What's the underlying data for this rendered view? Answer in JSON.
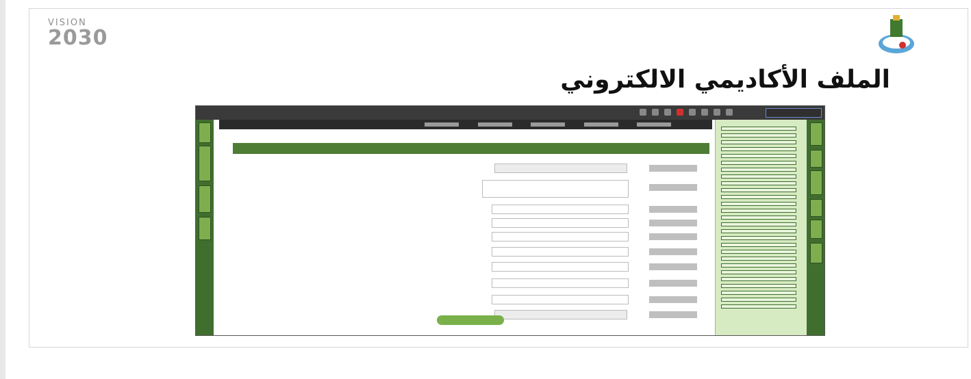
{
  "slide": {
    "title": "الملف الأكاديمي الالكتروني"
  },
  "vision_logo": {
    "line1": "VISION",
    "year": "2030"
  },
  "colors": {
    "accent_green": "#3f6e2e",
    "submit_green": "#79b04a",
    "sidebar_bg": "#d7ebc3"
  },
  "icons": [
    "university-logo",
    "vision-2030-logo"
  ]
}
